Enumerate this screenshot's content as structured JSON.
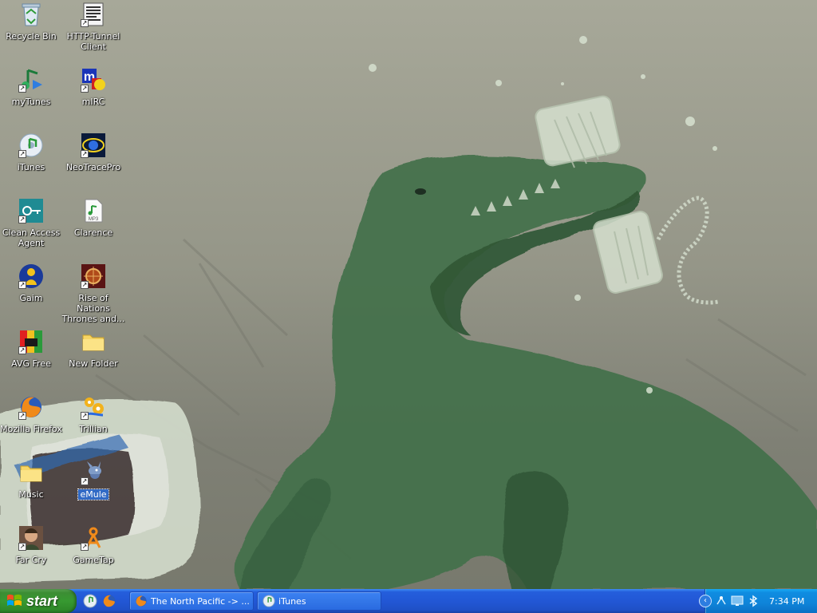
{
  "desktop": {
    "icons": [
      {
        "label": "Recycle Bin",
        "icon": "recycle-bin-icon"
      },
      {
        "label": "HTTP-Tunnel Client",
        "icon": "http-tunnel-icon"
      },
      {
        "label": "myTunes",
        "icon": "mytunes-icon"
      },
      {
        "label": "mIRC",
        "icon": "mirc-icon"
      },
      {
        "label": "iTunes",
        "icon": "itunes-icon"
      },
      {
        "label": "NeoTracePro",
        "icon": "neotrace-icon"
      },
      {
        "label": "Clean Access Agent",
        "icon": "clean-access-icon"
      },
      {
        "label": "Clarence",
        "icon": "mp3-file-icon"
      },
      {
        "label": "Gaim",
        "icon": "gaim-icon"
      },
      {
        "label": "Rise of Nations Thrones and...",
        "icon": "rise-of-nations-icon"
      },
      {
        "label": "AVG Free",
        "icon": "avg-icon"
      },
      {
        "label": "New Folder",
        "icon": "folder-icon"
      },
      {
        "label": "Mozilla Firefox",
        "icon": "firefox-icon"
      },
      {
        "label": "Trillian",
        "icon": "trillian-icon"
      },
      {
        "label": "Music",
        "icon": "folder-icon"
      },
      {
        "label": "eMule",
        "icon": "emule-icon"
      },
      {
        "label": "Far Cry",
        "icon": "far-cry-icon"
      },
      {
        "label": "GameTap",
        "icon": "gametap-icon"
      }
    ],
    "selected": "eMule"
  },
  "taskbar": {
    "start_label": "start",
    "quick_launch": [
      "itunes-icon",
      "firefox-icon"
    ],
    "tasks": [
      {
        "label": "The North Pacific -> ...",
        "icon": "firefox-icon"
      },
      {
        "label": "iTunes",
        "icon": "itunes-icon"
      }
    ],
    "tray": {
      "icons": [
        "network-icon",
        "monitor-icon",
        "bluetooth-icon"
      ],
      "clock": "7:34 PM"
    }
  },
  "colors": {
    "taskbar_blue": "#245edc",
    "start_green": "#379931",
    "tray_blue": "#0f8ce1",
    "wallpaper_base": "#959688",
    "dinosaur_green": "#3e6a3e"
  }
}
